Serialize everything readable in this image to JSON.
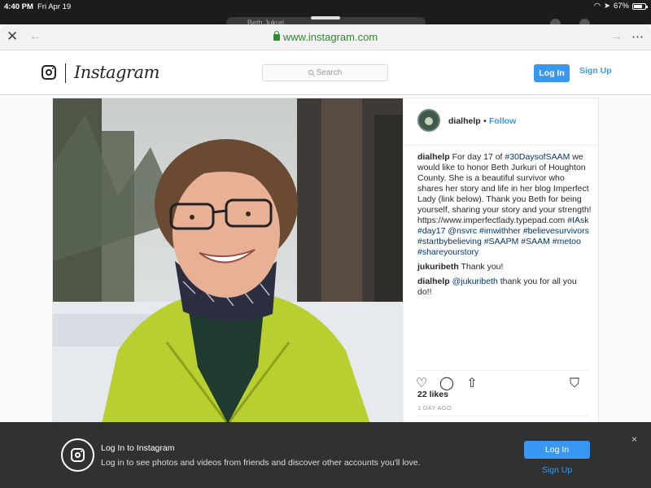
{
  "status_bar": {
    "time": "4:40 PM",
    "date": "Fri Apr 19",
    "battery": "67%",
    "background_tab_text": "Beth Jukuri"
  },
  "browser": {
    "url": "www.instagram.com",
    "close_icon": "close-icon",
    "back_icon": "back-arrow-icon",
    "forward_icon": "forward-arrow-icon",
    "more_icon": "more-options-icon"
  },
  "instagram_header": {
    "wordmark": "Instagram",
    "search_placeholder": "Search",
    "login_label": "Log In",
    "signup_label": "Sign Up",
    "accent": "#3897f0"
  },
  "post": {
    "username": "dialhelp",
    "dot": "•",
    "follow_label": "Follow",
    "caption_user": "dialhelp",
    "caption_parts": [
      {
        "text": "For day 17 of ",
        "hash": false
      },
      {
        "text": "#30DaysofSAAM",
        "hash": true
      },
      {
        "text": " we would like to honor Beth Jurkuri of Houghton County. She is a beautiful survivor who shares her story and life in her blog Imperfect Lady (link below). Thank you Beth for being yourself, sharing your story and your strength! https://www.imperfectlady.typepad.com ",
        "hash": false
      },
      {
        "text": "#IAsk",
        "hash": true
      },
      {
        "text": " ",
        "hash": false
      },
      {
        "text": "#day17",
        "hash": true
      },
      {
        "text": " ",
        "hash": false
      },
      {
        "text": "@nsvrc",
        "hash": true
      },
      {
        "text": " ",
        "hash": false
      },
      {
        "text": "#imwithher",
        "hash": true
      },
      {
        "text": " ",
        "hash": false
      },
      {
        "text": "#believesurvivors",
        "hash": true
      },
      {
        "text": " ",
        "hash": false
      },
      {
        "text": "#startbybelieving",
        "hash": true
      },
      {
        "text": " ",
        "hash": false
      },
      {
        "text": "#SAAPM",
        "hash": true
      },
      {
        "text": " ",
        "hash": false
      },
      {
        "text": "#SAAM",
        "hash": true
      },
      {
        "text": " ",
        "hash": false
      },
      {
        "text": "#metoo",
        "hash": true
      },
      {
        "text": " ",
        "hash": false
      },
      {
        "text": "#shareyourstory",
        "hash": true
      }
    ],
    "comments": [
      {
        "user": "jukuribeth",
        "text": " Thank you!",
        "mention": ""
      },
      {
        "user": "dialhelp",
        "mention": "@jukuribeth",
        "text": " thank you for all you do!!"
      }
    ],
    "likes": "22 likes",
    "time_ago": "1 DAY AGO"
  },
  "banner": {
    "title": "Log In to Instagram",
    "text": "Log in to see photos and videos from friends and discover other accounts you'll love.",
    "login_label": "Log In",
    "signup_label": "Sign Up",
    "close": "×"
  }
}
